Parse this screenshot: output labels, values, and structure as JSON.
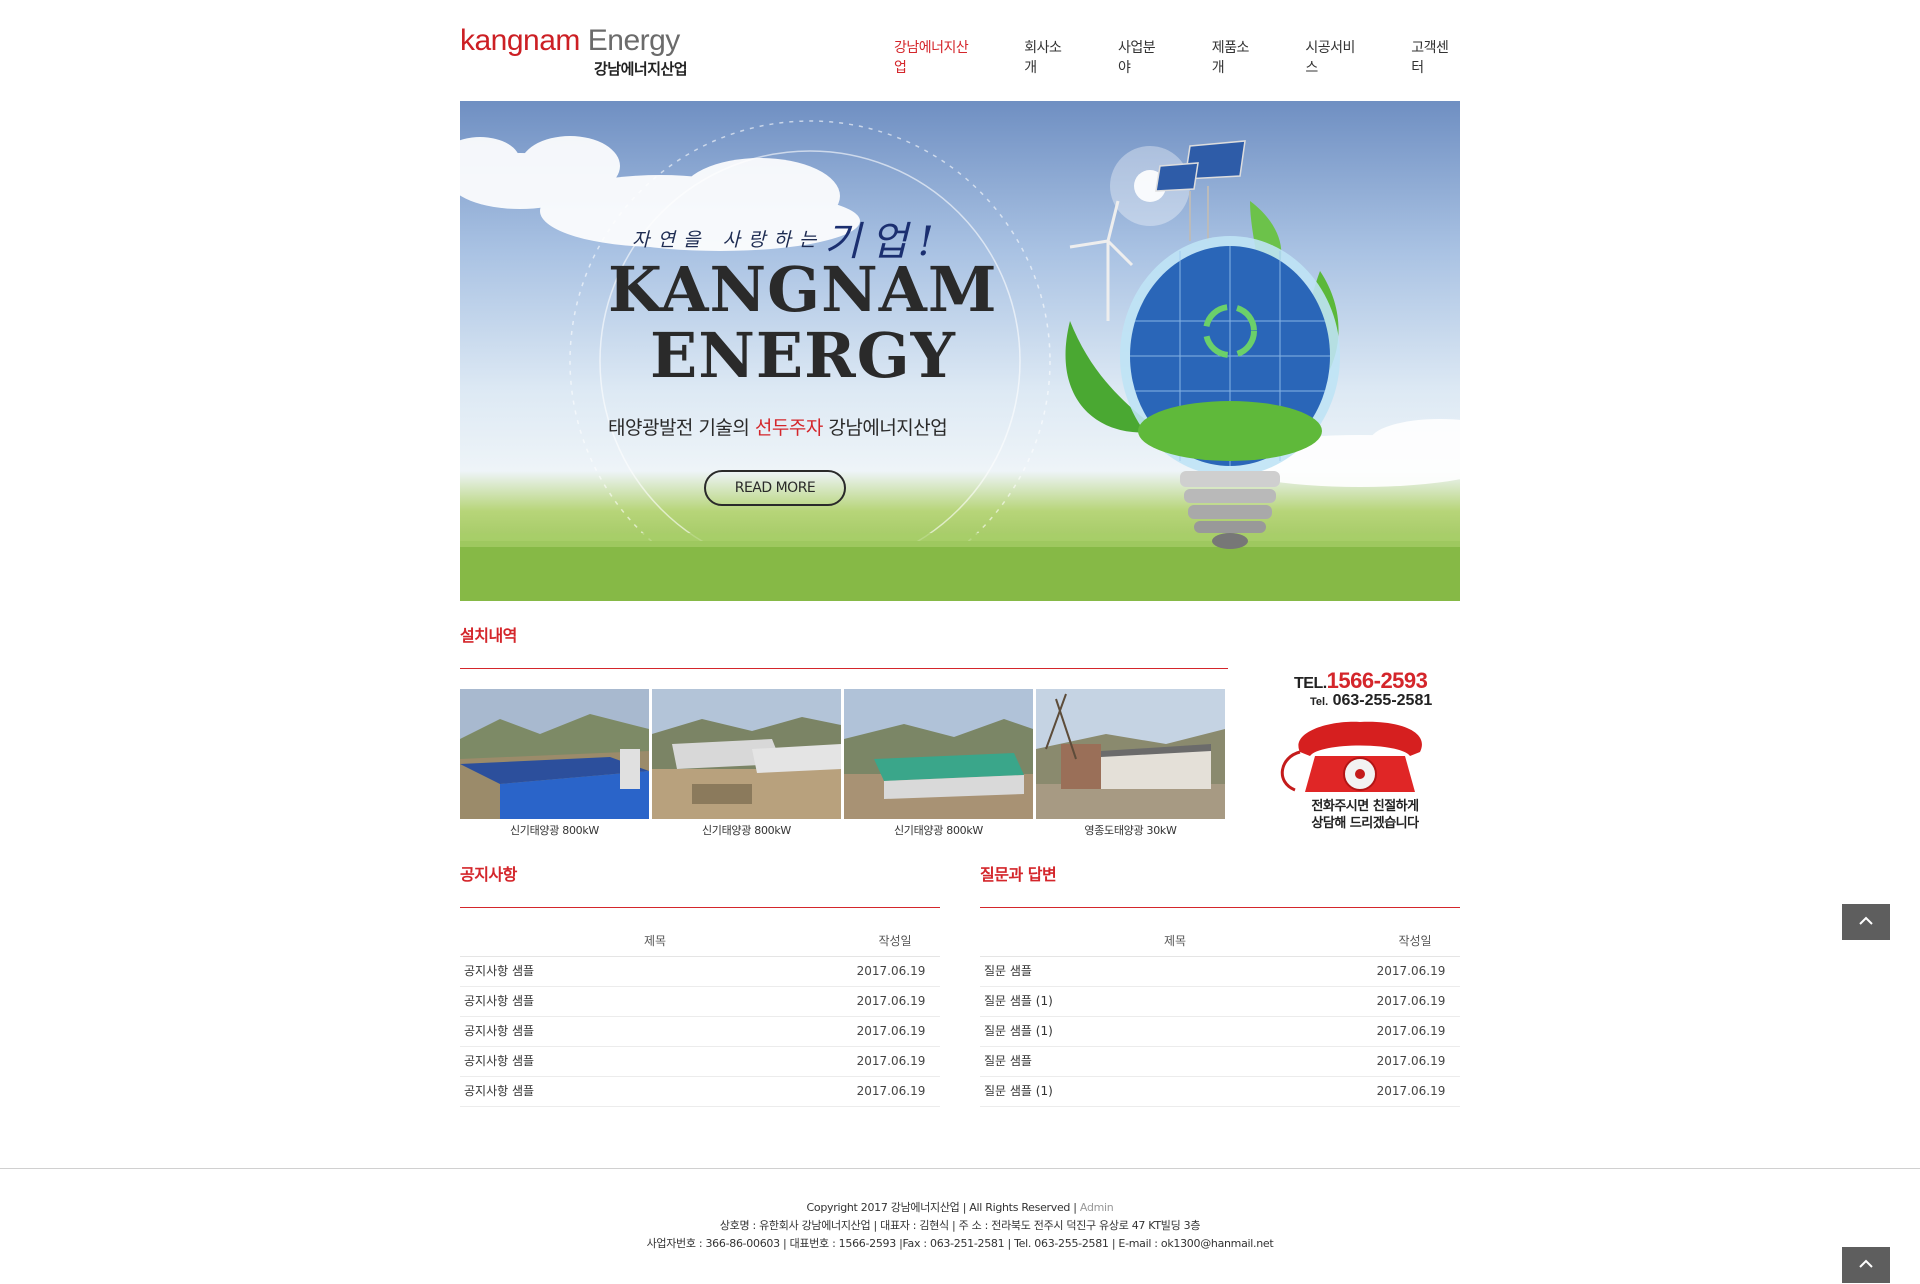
{
  "header": {
    "logo_main_red": "kangnam",
    "logo_main_grey": " Energy",
    "logo_sub": "강남에너지산업",
    "nav": [
      {
        "label": "강남에너지산업",
        "active": true
      },
      {
        "label": "회사소개"
      },
      {
        "label": "사업분야"
      },
      {
        "label": "제품소개"
      },
      {
        "label": "시공서비스"
      },
      {
        "label": "고객센터"
      }
    ]
  },
  "hero": {
    "script_small": "자연을 사랑하는",
    "script_big": "기업!",
    "title_line1": "KANGNAM",
    "title_line2": "ENERGY",
    "slogan_pre": "태양광발전 기술의 ",
    "slogan_highlight": "선두주자",
    "slogan_post": " 강남에너지산업",
    "button_label": "READ MORE"
  },
  "install": {
    "title": "설치내역",
    "items": [
      {
        "caption": "신기태양광 800kW"
      },
      {
        "caption": "신기태양광 800kW"
      },
      {
        "caption": "신기태양광 800kW"
      },
      {
        "caption": "영종도태양광 30kW"
      }
    ]
  },
  "phone_ad": {
    "tel_prefix": "TEL.",
    "tel_main": "1566-2593",
    "tel2_prefix": "Tel.",
    "tel2": "063-255-2581",
    "caption_line1": "전화주시면 친절하게",
    "caption_line2": "상담해 드리겠습니다"
  },
  "notice": {
    "title": "공지사항",
    "col_title": "제목",
    "col_date": "작성일",
    "rows": [
      {
        "title": "공지사항 샘플",
        "date": "2017.06.19"
      },
      {
        "title": "공지사항 샘플",
        "date": "2017.06.19"
      },
      {
        "title": "공지사항 샘플",
        "date": "2017.06.19"
      },
      {
        "title": "공지사항 샘플",
        "date": "2017.06.19"
      },
      {
        "title": "공지사항 샘플",
        "date": "2017.06.19"
      }
    ]
  },
  "qna": {
    "title": "질문과 답변",
    "col_title": "제목",
    "col_date": "작성일",
    "rows": [
      {
        "title": "질문 샘플",
        "date": "2017.06.19"
      },
      {
        "title": "질문 샘플 (1)",
        "date": "2017.06.19"
      },
      {
        "title": "질문 샘플 (1)",
        "date": "2017.06.19"
      },
      {
        "title": "질문 샘플",
        "date": "2017.06.19"
      },
      {
        "title": "질문 샘플 (1)",
        "date": "2017.06.19"
      }
    ]
  },
  "footer": {
    "copyright": "Copyright 2017 강남에너지산업 | All Rights Reserved | ",
    "admin_link": "Admin",
    "line2": "상호명 : 유한회사 강남에너지산업 | 대표자 : 김현식 | 주 소 : 전라북도 전주시 덕진구 유상로 47 KT빌딩 3층",
    "line3": "사업자번호 : 366-86-00603 | 대표번호 : 1566-2593 |Fax : 063-251-2581 | Tel. 063-255-2581 | E-mail : ok1300@hanmail.net"
  },
  "colors": {
    "accent": "#d4262b",
    "top_button": "#5e5e5e"
  }
}
